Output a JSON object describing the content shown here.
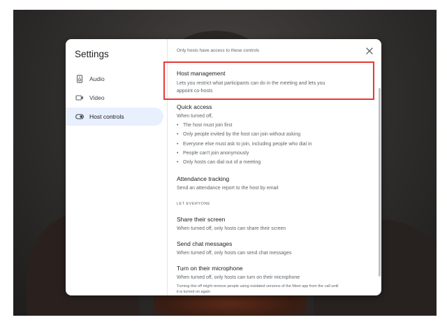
{
  "dialog": {
    "title": "Settings",
    "top_note": "Only hosts have access to these controls",
    "close_icon": "close-icon"
  },
  "sidebar": {
    "items": [
      {
        "label": "Audio",
        "icon": "speaker-icon",
        "active": false
      },
      {
        "label": "Video",
        "icon": "video-camera-icon",
        "active": false
      },
      {
        "label": "Host controls",
        "icon": "toggle-icon",
        "active": true
      }
    ]
  },
  "settings": {
    "host_management": {
      "title": "Host management",
      "desc": "Lets you restrict what participants can do in the meeting and lets you appoint co-hosts",
      "on": true
    },
    "quick_access": {
      "title": "Quick access",
      "desc": "When turned off,",
      "bullets": [
        "The host must join first",
        "Only people invited by the host can join without asking",
        "Everyone else must ask to join, including people who dial in",
        "People can't join anonymously",
        "Only hosts can dial out of a meeting"
      ],
      "on": true
    },
    "attendance": {
      "title": "Attendance tracking",
      "desc": "Send an attendance report to the host by email",
      "on": false
    },
    "section_label": "LET EVERYONE",
    "share_screen": {
      "title": "Share their screen",
      "desc": "When turned off, only hosts can share their screen",
      "on": true
    },
    "chat": {
      "title": "Send chat messages",
      "desc": "When turned off, only hosts can send chat messages",
      "on": true
    },
    "microphone": {
      "title": "Turn on their microphone",
      "desc": "When turned off, only hosts can turn on their microphone",
      "note": "Turning this off might remove people using outdated versions of the Meet app from the call until it is turned on again",
      "on": true
    }
  },
  "colors": {
    "accent": "#1a73e8",
    "highlight": "#e53935",
    "active_nav": "#e8f0fe"
  }
}
